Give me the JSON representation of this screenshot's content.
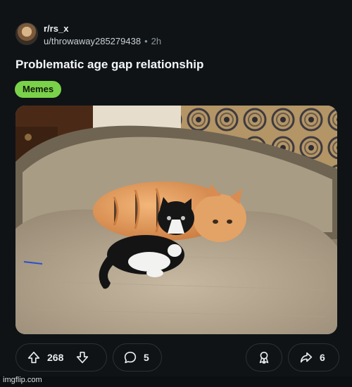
{
  "post": {
    "subreddit": "r/rs_x",
    "author": "u/throwaway285279438",
    "separator": "•",
    "time": "2h",
    "title": "Problematic age gap relationship",
    "flair": "Memes",
    "flair_color": "#7ad14a"
  },
  "actions": {
    "upvotes": "268",
    "comments": "5",
    "shares": "6"
  },
  "icons": {
    "upvote": "arrow-up-icon",
    "downvote": "arrow-down-icon",
    "comment": "comment-bubble-icon",
    "award": "award-ribbon-icon",
    "share": "share-arrow-icon"
  },
  "watermark": "imgflip.com"
}
